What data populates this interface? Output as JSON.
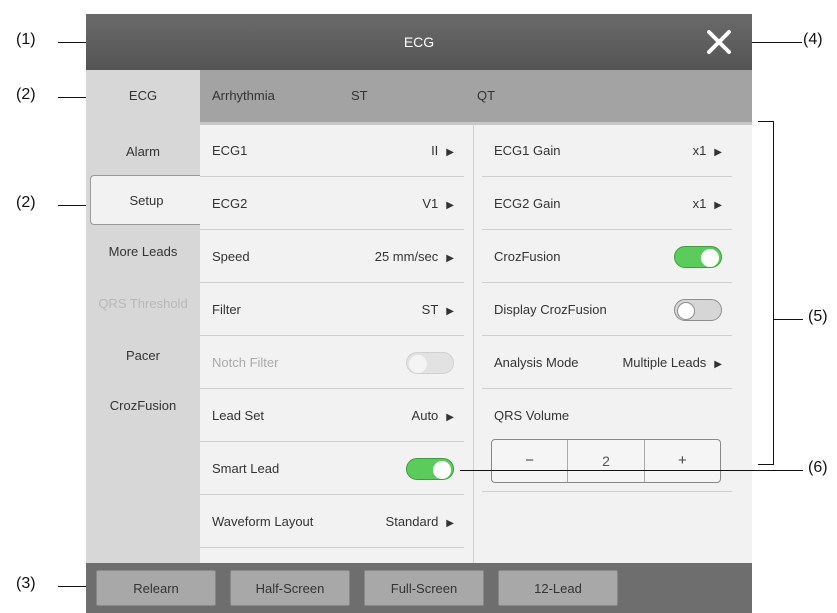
{
  "callouts": [
    "(1)",
    "(2)",
    "(2)",
    "(3)",
    "(4)",
    "(5)",
    "(6)"
  ],
  "window": {
    "title": "ECG",
    "close_icon": "close-icon"
  },
  "tabs": [
    {
      "label": "ECG",
      "active": true
    },
    {
      "label": "Arrhythmia",
      "active": false
    },
    {
      "label": "ST",
      "active": false
    },
    {
      "label": "QT",
      "active": false
    }
  ],
  "sidebar": [
    {
      "label": "Alarm"
    },
    {
      "label": "Setup",
      "active": true
    },
    {
      "label": "More Leads"
    },
    {
      "label": "QRS Threshold",
      "disabled": true
    },
    {
      "label": "Pacer"
    },
    {
      "label": "CrozFusion"
    }
  ],
  "left_column": [
    {
      "label": "ECG1",
      "value": "II",
      "arrow": "▶"
    },
    {
      "label": "ECG2",
      "value": "V1",
      "arrow": "▶"
    },
    {
      "label": "Speed",
      "value": "25 mm/sec",
      "arrow": "▶"
    },
    {
      "label": "Filter",
      "value": "ST",
      "arrow": "▶"
    },
    {
      "label": "Notch Filter",
      "toggle": "disabled"
    },
    {
      "label": "Lead Set",
      "value": "Auto",
      "arrow": "▶"
    },
    {
      "label": "Smart Lead",
      "toggle": "on"
    },
    {
      "label": "Waveform Layout",
      "value": "Standard",
      "arrow": "▶"
    }
  ],
  "right_column": [
    {
      "label": "ECG1 Gain",
      "value": "x1",
      "arrow": "▶"
    },
    {
      "label": "ECG2 Gain",
      "value": "x1",
      "arrow": "▶"
    },
    {
      "label": "CrozFusion",
      "toggle": "on"
    },
    {
      "label": "Display CrozFusion",
      "toggle": "off"
    },
    {
      "label": "Analysis Mode",
      "value": "Multiple Leads",
      "arrow": "▶"
    },
    {
      "label": "QRS Volume"
    }
  ],
  "qrs_volume": {
    "minus": "−",
    "value": "2",
    "plus": "+"
  },
  "bottom_buttons": [
    "Relearn",
    "Half-Screen",
    "Full-Screen",
    "12-Lead"
  ]
}
